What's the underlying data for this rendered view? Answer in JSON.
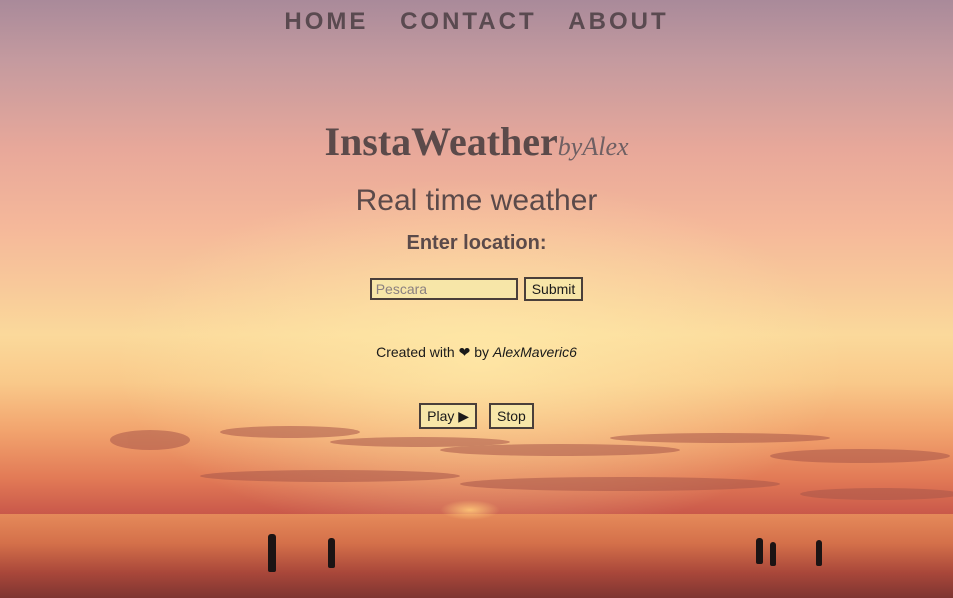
{
  "nav": {
    "items": [
      "HOME",
      "CONTACT",
      "ABOUT"
    ]
  },
  "brand": {
    "name": "InstaWeather",
    "by": "byAlex"
  },
  "main": {
    "subtitle": "Real time weather",
    "location_label": "Enter location:",
    "location_placeholder": "Pescara",
    "submit_label": "Submit"
  },
  "credit": {
    "prefix": "Created with",
    "heart": "❤",
    "by": "by",
    "author": "AlexMaveric6"
  },
  "audio": {
    "play_label": "Play ▶",
    "stop_label": "Stop"
  },
  "colors": {
    "text": "#5b4a4a",
    "button_bg": "#f7e6a8",
    "button_border": "#4a3f3a"
  }
}
